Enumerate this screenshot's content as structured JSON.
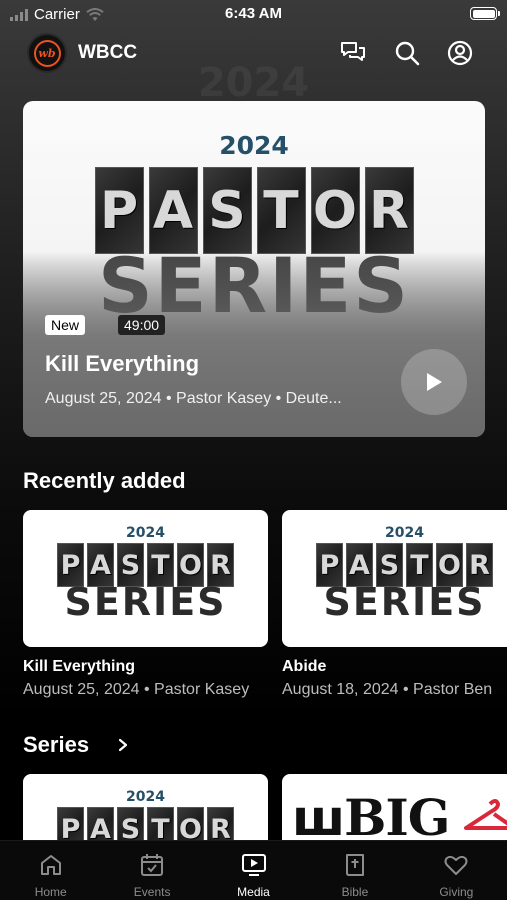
{
  "status_bar": {
    "carrier": "Carrier",
    "time": "6:43 AM"
  },
  "header": {
    "logo_text": "wb",
    "app_title": "WBCC",
    "icons": [
      "chat-icon",
      "search-icon",
      "profile-icon"
    ]
  },
  "artwork": {
    "year": "2024",
    "word1": [
      "P",
      "A",
      "S",
      "T",
      "O",
      "R"
    ],
    "word2": "SERIES"
  },
  "hero": {
    "badge_new": "New",
    "duration": "49:00",
    "title": "Kill Everything",
    "meta": "August 25, 2024 • Pastor Kasey • Deute..."
  },
  "recently_added": {
    "title": "Recently added",
    "items": [
      {
        "title": "Kill Everything",
        "meta": "August 25, 2024 • Pastor Kasey"
      },
      {
        "title": "Abide",
        "meta": "August 18, 2024 • Pastor Ben"
      }
    ]
  },
  "series": {
    "title": "Series",
    "big_art_text": "BIG"
  },
  "tabs": [
    {
      "label": "Home",
      "icon": "home-icon",
      "active": false
    },
    {
      "label": "Events",
      "icon": "calendar-icon",
      "active": false
    },
    {
      "label": "Media",
      "icon": "media-icon",
      "active": true
    },
    {
      "label": "Bible",
      "icon": "bible-icon",
      "active": false
    },
    {
      "label": "Giving",
      "icon": "heart-icon",
      "active": false
    }
  ],
  "colors": {
    "accent_logo": "#e8551e",
    "year_text": "#264f68",
    "active_tab": "#ffffff",
    "inactive_tab": "#8c8c8c"
  }
}
